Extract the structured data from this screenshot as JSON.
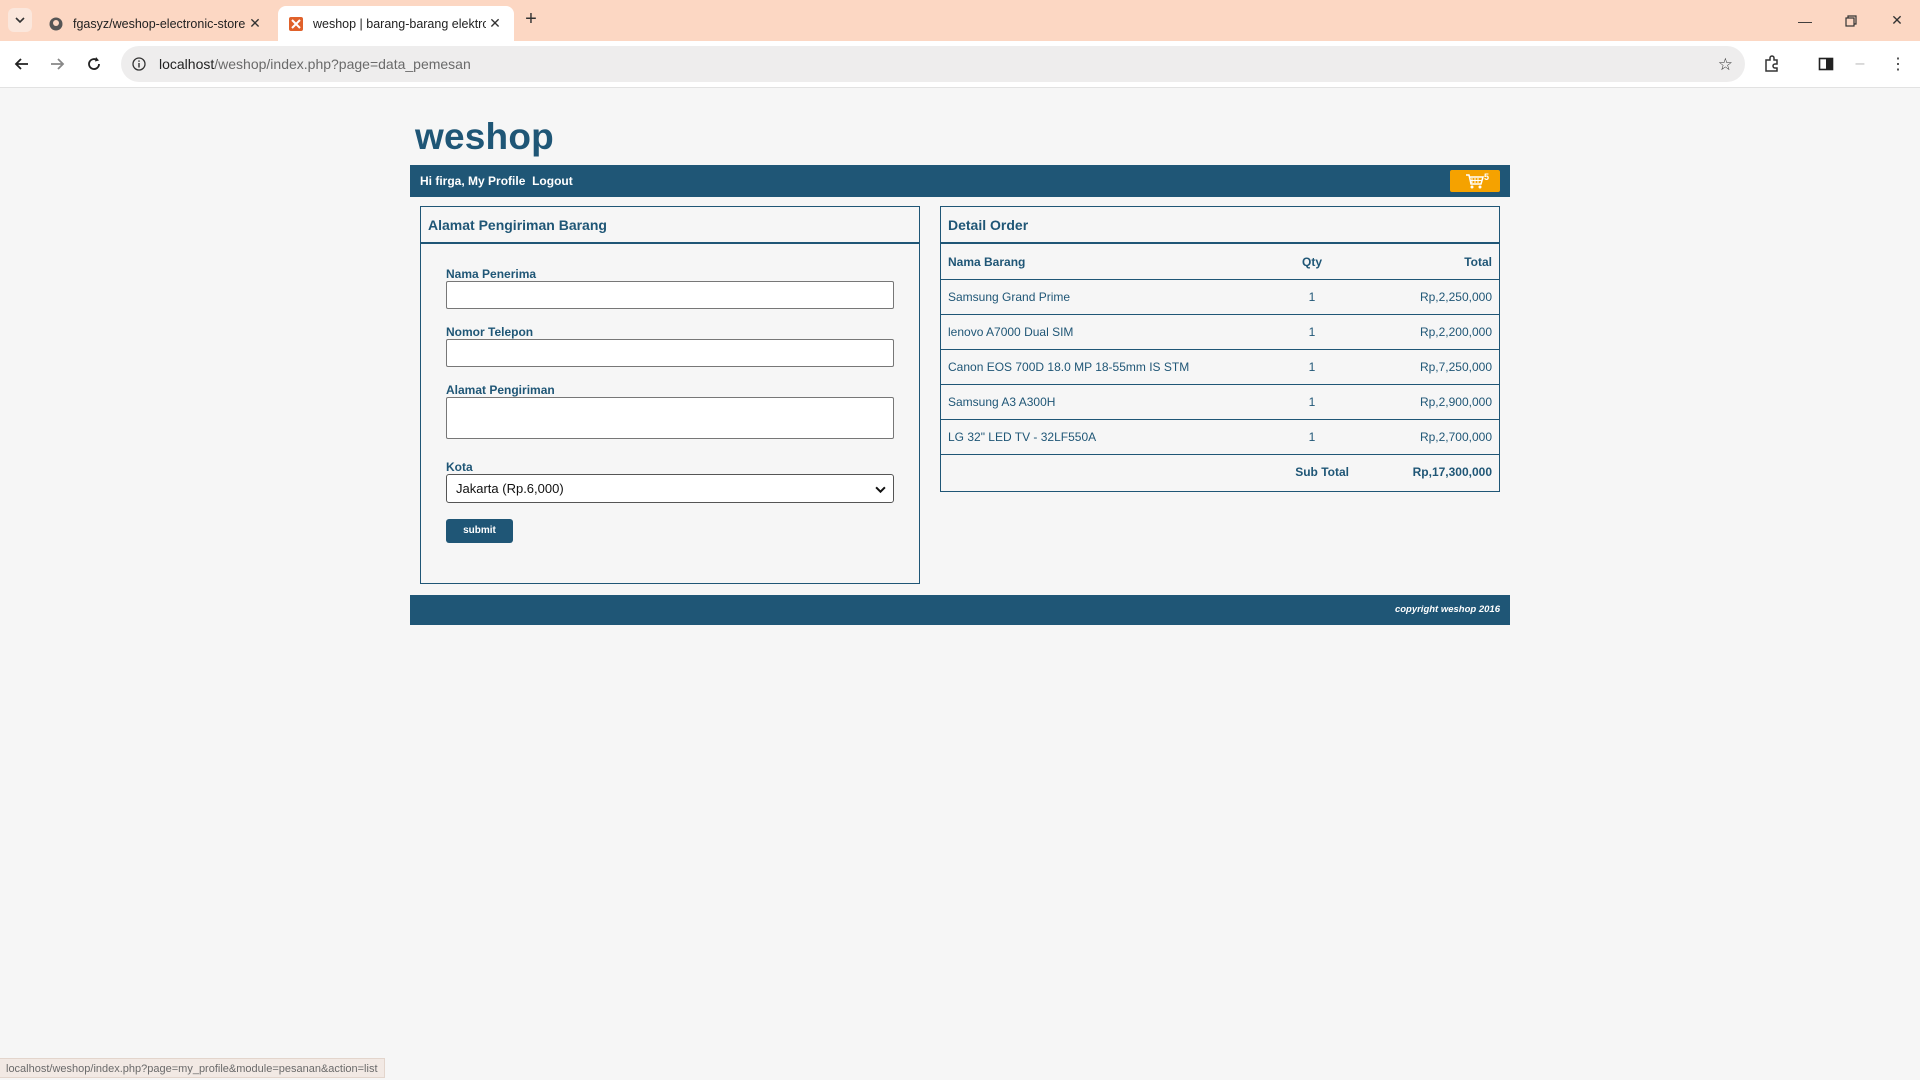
{
  "browser": {
    "tabs": [
      {
        "title": "fgasyz/weshop-electronic-store",
        "active": false
      },
      {
        "title": "weshop | barang-barang elektronik",
        "active": true
      }
    ],
    "url_host": "localhost",
    "url_path": "/weshop/index.php?page=data_pemesan",
    "status_url": "localhost/weshop/index.php?page=my_profile&module=pesanan&action=list"
  },
  "site": {
    "brand": "weshop",
    "nav": {
      "greeting_prefix": "Hi ",
      "username": "firga",
      "comma": ",",
      "profile_link": "My Profile",
      "logout_link": "Logout",
      "cart_count": "5"
    },
    "shipping_form": {
      "title": "Alamat Pengiriman Barang",
      "fields": {
        "name_label": "Nama Penerima",
        "name_value": "",
        "phone_label": "Nomor Telepon",
        "phone_value": "",
        "address_label": "Alamat Pengiriman",
        "address_value": "",
        "city_label": "Kota",
        "city_selected": "Jakarta (Rp.6,000)"
      },
      "submit_label": "submit"
    },
    "order": {
      "title": "Detail Order",
      "headers": [
        "Nama Barang",
        "Qty",
        "Total"
      ],
      "rows": [
        {
          "name": "Samsung Grand Prime",
          "qty": "1",
          "total": "Rp,2,250,000"
        },
        {
          "name": "lenovo A7000 Dual SIM",
          "qty": "1",
          "total": "Rp,2,200,000"
        },
        {
          "name": "Canon EOS 700D 18.0 MP 18-55mm IS STM",
          "qty": "1",
          "total": "Rp,7,250,000"
        },
        {
          "name": "Samsung A3 A300H",
          "qty": "1",
          "total": "Rp,2,900,000"
        },
        {
          "name": "LG 32\" LED TV - 32LF550A",
          "qty": "1",
          "total": "Rp,2,700,000"
        }
      ],
      "subtotal_label": "Sub Total",
      "subtotal_value": "Rp,17,300,000"
    },
    "footer": "copyright weshop 2016"
  },
  "colors": {
    "brand": "#1f5676",
    "cart": "#f5a200",
    "tabbar": "#fcd7c3"
  }
}
